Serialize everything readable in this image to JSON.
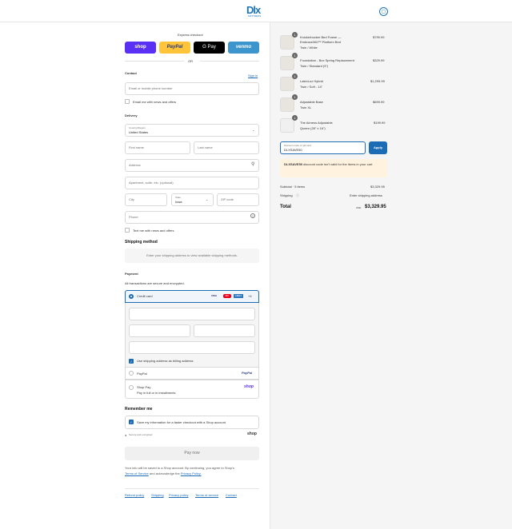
{
  "header": {
    "logo_text": "Dlx",
    "logo_tag": "MATTRESS",
    "bag_icon": "shopping-bag-icon"
  },
  "express": {
    "title": "Express checkout",
    "shop": "shop",
    "paypal": "PayPal",
    "gpay": "G Pay",
    "venmo": "venmo",
    "or": "OR"
  },
  "contact": {
    "heading": "Contact",
    "signin": "Sign in",
    "email_placeholder": "Email or mobile phone number",
    "news": "Email me with news and offers"
  },
  "delivery": {
    "heading": "Delivery",
    "country_label": "Country/Region",
    "country_value": "United States",
    "first_name": "First name",
    "last_name": "Last name",
    "address": "Address",
    "apartment": "Apartment, suite, etc. (optional)",
    "city": "City",
    "state_label": "State",
    "state_value": "Iowa",
    "zip": "ZIP code",
    "phone": "Phone",
    "text_news": "Text me with news and offers"
  },
  "shipping_method": {
    "heading": "Shipping method",
    "note": "Enter your shipping address to view available shipping methods."
  },
  "payment": {
    "heading": "Payment",
    "sub": "All transactions are secure and encrypted.",
    "credit_card": "Credit card",
    "card_brands": [
      "VISA",
      "MC",
      "AMEX",
      "+4"
    ],
    "billing": "Use shipping address as billing address",
    "paypal": "PayPal",
    "paypal_logo": "PayPal",
    "shop_pay": "Shop Pay",
    "shop_pay_sub": "Pay in full or in installments",
    "shop_logo": "shop"
  },
  "remember": {
    "heading": "Remember me",
    "save": "Save my information for a faster checkout with a Shop account",
    "secure": "Secure and encrypted",
    "shop_logo": "shop"
  },
  "pay_now": "Pay now",
  "legal": {
    "line1": "Your info will be saved to a Shop account. By continuing, you agree to Shop's",
    "terms": "Terms of Service",
    "and": "and acknowledge the",
    "privacy": "Privacy Policy."
  },
  "footer": [
    "Refund policy",
    "Shipping",
    "Privacy policy",
    "Terms of service",
    "Contact"
  ],
  "items": [
    {
      "qty": "1",
      "name1": "Knickerbocker Bed Frame —",
      "name2": "Embrace360™ Platform Bed",
      "variant": "Twin / White",
      "price": "$799.99"
    },
    {
      "qty": "1",
      "name1": "Foundation - Box Spring Replacement",
      "name2": "",
      "variant": "Twin / Standard (9\")",
      "price": "$329.99"
    },
    {
      "qty": "1",
      "name1": "LatexLux Hybrid",
      "name2": "",
      "variant": "Twin / Soft - 14\"",
      "price": "$1,299.99"
    },
    {
      "qty": "1",
      "name1": "Adjustable Base",
      "name2": "",
      "variant": "Twin XL",
      "price": "$699.99"
    },
    {
      "qty": "1",
      "name1": "The Airness Adjustable",
      "name2": "",
      "variant": "Queen (28\" x 16\")",
      "price": "$199.99"
    }
  ],
  "discount": {
    "label": "Discount code or gift card",
    "value": "DLXSAVE50",
    "apply": "Apply",
    "warn_code": "DLXSAVE50",
    "warn_text": "discount code isn't valid for the items in your cart"
  },
  "summary": {
    "subtotal_label": "Subtotal · 5 items",
    "subtotal": "$3,329.95",
    "shipping_label": "Shipping",
    "shipping": "Enter shipping address",
    "total_label": "Total",
    "currency": "USD",
    "total": "$3,329.95"
  }
}
